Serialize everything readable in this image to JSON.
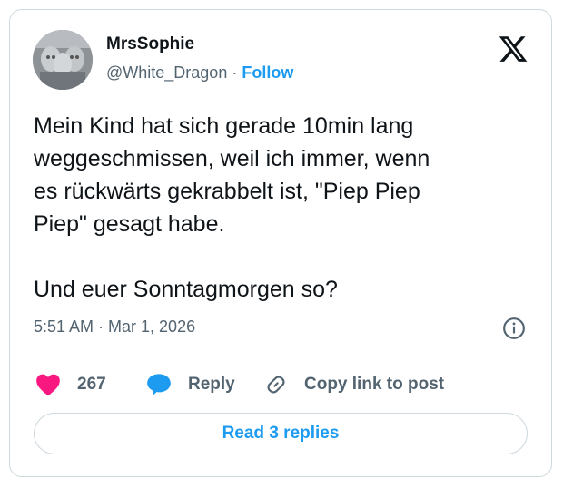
{
  "author": {
    "display_name": "MrsSophie",
    "handle": "@White_Dragon",
    "separator": " · ",
    "follow_label": "Follow"
  },
  "post": {
    "text": "Mein Kind hat sich gerade 10min lang\nweggeschmissen, weil ich immer, wenn\nes rückwärts gekrabbelt ist, \"Piep Piep\nPiep\" gesagt habe.\n\nUnd euer Sonntagmorgen so?",
    "timestamp": "5:51 AM · Mar 1, 2026"
  },
  "actions": {
    "like_count": "267",
    "reply_label": "Reply",
    "copy_link_label": "Copy link to post",
    "read_replies_label": "Read 3 replies"
  },
  "colors": {
    "accent": "#1d9bf0",
    "like": "#f91880",
    "muted": "#536471",
    "border": "#cfd9de"
  },
  "icons": [
    "avatar-image",
    "x-logo-icon",
    "info-icon",
    "heart-icon",
    "reply-bubble-icon",
    "link-icon"
  ]
}
